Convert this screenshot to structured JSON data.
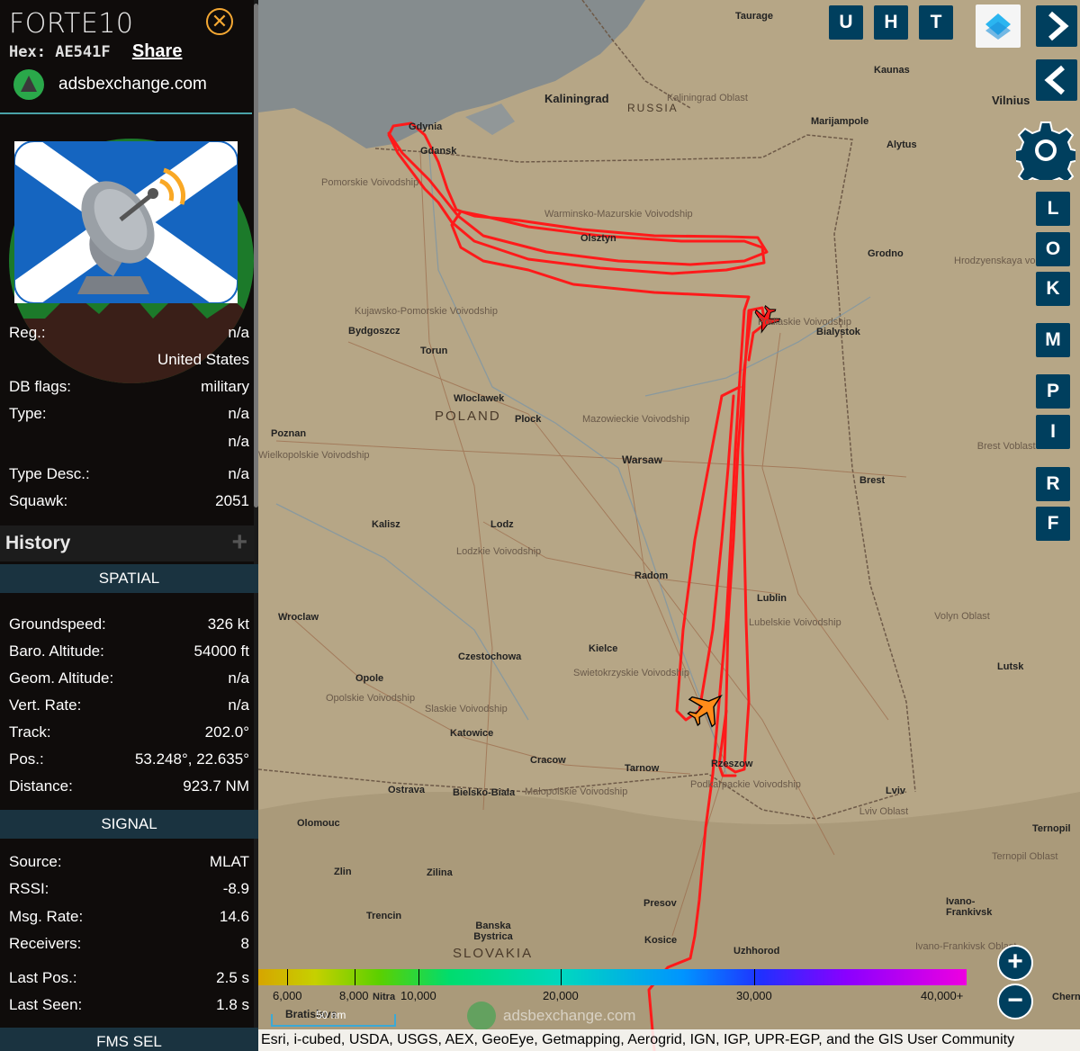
{
  "header": {
    "callsign": "FORTE10",
    "hex_label": "Hex:",
    "hex_value": "AE541F",
    "share_label": "Share",
    "site_name": "adsbexchange.com"
  },
  "info": {
    "reg_label": "Reg.:",
    "reg_value": "n/a",
    "country": "United States",
    "dbflags_label": "DB flags:",
    "dbflags_value": "military",
    "type_label": "Type:",
    "type_value": "n/a",
    "type_value2": "n/a",
    "typedesc_label": "Type Desc.:",
    "typedesc_value": "n/a",
    "squawk_label": "Squawk:",
    "squawk_value": "2051"
  },
  "history": {
    "title": "History",
    "plus": "+"
  },
  "spatial": {
    "title": "SPATIAL",
    "rows": [
      {
        "label": "Groundspeed:",
        "value": "326 kt"
      },
      {
        "label": "Baro. Altitude:",
        "value": "54000 ft"
      },
      {
        "label": "Geom. Altitude:",
        "value": "n/a"
      },
      {
        "label": "Vert. Rate:",
        "value": "n/a"
      },
      {
        "label": "Track:",
        "value": "202.0°"
      },
      {
        "label": "Pos.:",
        "value": "53.248°, 22.635°"
      },
      {
        "label": "Distance:",
        "value": "923.7 NM"
      }
    ]
  },
  "signal": {
    "title": "SIGNAL",
    "rows": [
      {
        "label": "Source:",
        "value": "MLAT"
      },
      {
        "label": "RSSI:",
        "value": "-8.9"
      },
      {
        "label": "Msg. Rate:",
        "value": "14.6"
      },
      {
        "label": "Receivers:",
        "value": "8"
      }
    ],
    "rows2": [
      {
        "label": "Last Pos.:",
        "value": "2.5 s"
      },
      {
        "label": "Last Seen:",
        "value": "1.8 s"
      }
    ]
  },
  "fms": {
    "title": "FMS SEL"
  },
  "map": {
    "top_buttons": [
      "U",
      "H",
      "T"
    ],
    "side_buttons": [
      "L",
      "O",
      "K",
      "M",
      "P",
      "I",
      "R",
      "F"
    ],
    "cities": [
      "Taurage",
      "Kaunas",
      "Vilnius",
      "Kaliningrad",
      "Gdynia",
      "Gdansk",
      "Marijampole",
      "Alytus",
      "Olsztyn",
      "Grodno",
      "Bialystok",
      "Bydgoszcz",
      "Torun",
      "Wloclawek",
      "Plock",
      "Poznan",
      "Warsaw",
      "Brest",
      "Kalisz",
      "Lodz",
      "Radom",
      "Lublin",
      "Wroclaw",
      "Kielce",
      "Czestochowa",
      "Opole",
      "Katowice",
      "Cracow",
      "Tarnow",
      "Rzeszow",
      "Lviv",
      "Ostrava",
      "Bielsko-Biala",
      "Olomouc",
      "Zlin",
      "Zilina",
      "Trencin",
      "Presov",
      "Kosice",
      "Uzhhorod",
      "Lutsk",
      "Ternopil",
      "Ivano-Frankivsk",
      "Banska Bystrica",
      "Bratislava",
      "Nitra",
      "Chern"
    ],
    "regions": [
      "Kaliningrad Oblast",
      "Pomorskie Voivodship",
      "Warminsko-Mazurskie Voivodship",
      "Hrodzyenskaya voblasts'",
      "Kujawsko-Pomorskie Voivodship",
      "Podlaskie Voivodship",
      "Mazowieckie Voivodship",
      "Wielkopolskie Voivodship",
      "Lodzkie Voivodship",
      "Lubelskie Voivodship",
      "Swietokrzyskie Voivodship",
      "Opolskie Voivodship",
      "Slaskie Voivodship",
      "Malopolskie Voivodship",
      "Podkarpackie Voivodship",
      "Volyn Oblast",
      "Lviv Oblast",
      "Brest Voblasts'",
      "Ternopil Oblast",
      "Ivano-Frankivsk Oblast"
    ],
    "countries": [
      "RUSSIA",
      "POLAND",
      "SLOVAKIA"
    ],
    "legend": [
      "6,000",
      "8,000",
      "10,000",
      "20,000",
      "30,000",
      "40,000+"
    ],
    "scale_label": "50 nm",
    "watermark": "adsbexchange.com",
    "attribution": "Esri, i-cubed, USDA, USGS, AEX, GeoEye, Getmapping, Aerogrid, IGN, IGP, UPR-EGP, and the GIS User Community",
    "zoom_in": "+",
    "zoom_out": "−"
  },
  "colors": {
    "track": "#ff1a1a",
    "accent": "#003f5e",
    "close": "#f4a833",
    "section_header": "#1a3340",
    "selected_plane": "#ff8c1a"
  }
}
